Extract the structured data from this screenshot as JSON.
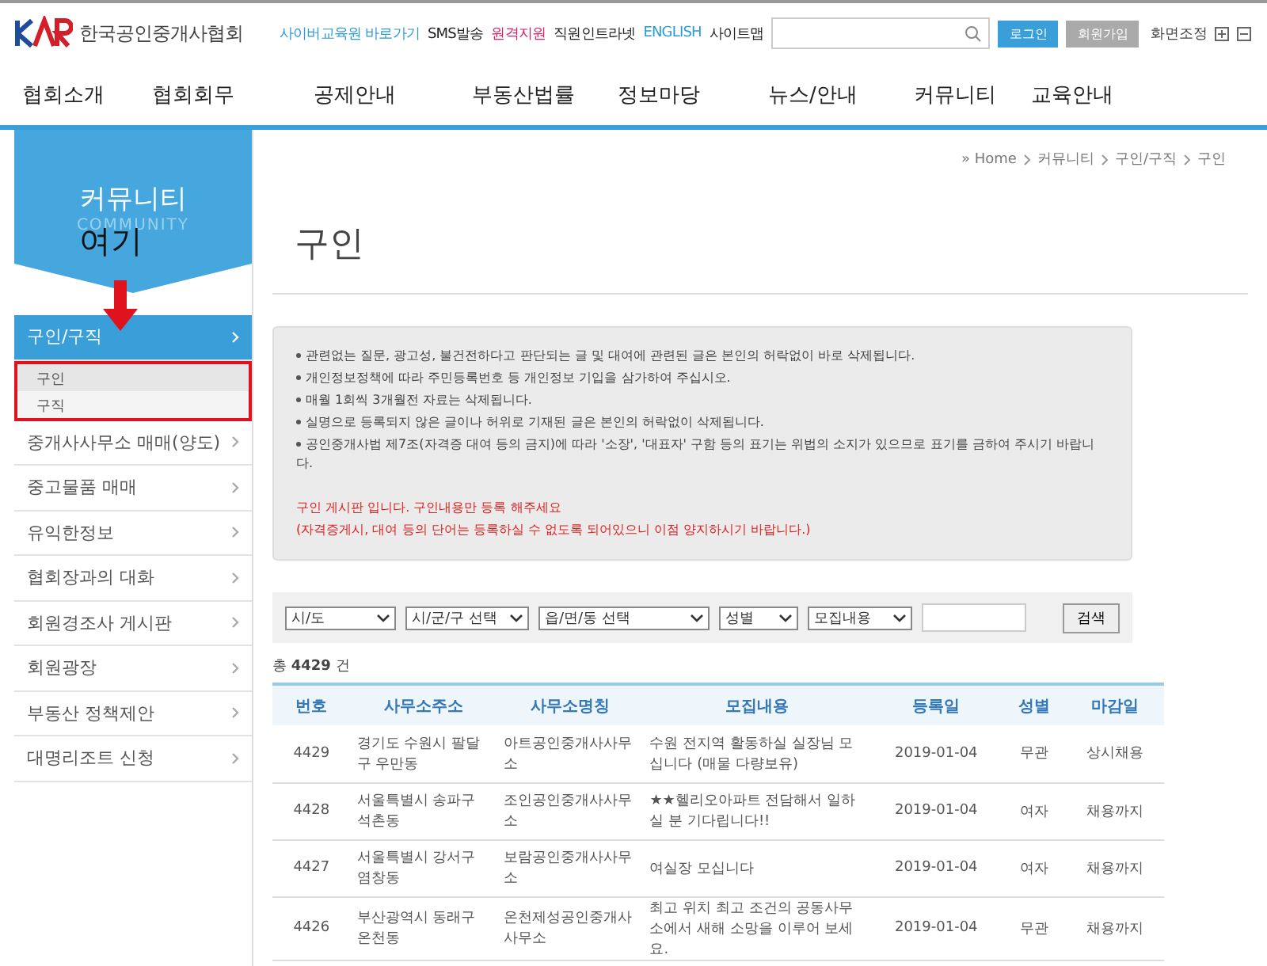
{
  "header": {
    "logo_text": "한국공인중개사협회",
    "links": [
      {
        "label": "사이버교육원 바로가기",
        "kind": "accent"
      },
      {
        "label": "SMS발송",
        "kind": "plain"
      },
      {
        "label": "원격지원",
        "kind": "alert"
      },
      {
        "label": "직원인트라넷",
        "kind": "plain"
      },
      {
        "label": "ENGLISH",
        "kind": "accent"
      },
      {
        "label": "사이트맵",
        "kind": "plain"
      }
    ],
    "login": "로그인",
    "join": "회원가입",
    "zoom_label": "화면조정"
  },
  "nav": [
    "협회소개",
    "협회회무",
    "공제안내",
    "부동산법률",
    "정보마당",
    "뉴스/안내",
    "커뮤니티",
    "교육안내"
  ],
  "sidebar": {
    "title": "커뮤니티",
    "subtitle": "COMMUNITY",
    "annotation": "여기",
    "items": [
      {
        "label": "구인/구직",
        "selected": true,
        "children": [
          {
            "label": "구인",
            "selected": true
          },
          {
            "label": "구직",
            "selected": false
          }
        ]
      },
      {
        "label": "중개사사무소 매매(양도)",
        "selected": false
      },
      {
        "label": "중고물품 매매",
        "selected": false
      },
      {
        "label": "유익한정보",
        "selected": false
      },
      {
        "label": "협회장과의 대화",
        "selected": false
      },
      {
        "label": "회원경조사 게시판",
        "selected": false
      },
      {
        "label": "회원광장",
        "selected": false
      },
      {
        "label": "부동산 정책제안",
        "selected": false
      },
      {
        "label": "대명리조트 신청",
        "selected": false
      }
    ]
  },
  "breadcrumb": [
    "» Home",
    "커뮤니티",
    "구인/구직",
    "구인"
  ],
  "page_title": "구인",
  "notice": {
    "items": [
      "관련없는 질문, 광고성, 불건전하다고 판단되는 글 및 대여에 관련된 글은 본인의 허락없이 바로 삭제됩니다.",
      "개인정보정책에 따라 주민등록번호 등 개인정보 기입을 삼가하여 주십시오.",
      "매월 1회씩 3개월전 자료는 삭제됩니다.",
      "실명으로 등록되지 않은 글이나 허위로 기재된 글은 본인의 허락없이 삭제됩니다.",
      "공인중개사법 제7조(자격증 대여 등의 금지)에 따라 '소장', '대표자' 구함 등의 표기는 위법의 소지가 있으므로 표기를 금하여 주시기 바랍니다."
    ],
    "warnings": [
      "구인 게시판 입니다. 구인내용만 등록 해주세요",
      "(자격증게시, 대여 등의 단어는 등록하실 수 없도록 되어있으니 이점 양지하시기 바랍니다.)"
    ]
  },
  "filters": [
    "시/도",
    "시/군/구 선택",
    "읍/면/동 선택",
    "성별",
    "모집내용"
  ],
  "search_button": "검색",
  "count": {
    "prefix": "총",
    "number": "4429",
    "suffix": "건"
  },
  "table": {
    "columns": [
      "번호",
      "사무소주소",
      "사무소명칭",
      "모집내용",
      "등록일",
      "성별",
      "마감일"
    ],
    "rows": [
      [
        "4429",
        "경기도 수원시 팔달구 우만동",
        "아트공인중개사사무소",
        "수원 전지역 활동하실 실장님 모십니다 (매물 다량보유)",
        "2019-01-04",
        "무관",
        "상시채용"
      ],
      [
        "4428",
        "서울특별시 송파구 석촌동",
        "조인공인중개사사무소",
        "★★헬리오아파트 전담해서 일하실 분 기다립니다!!",
        "2019-01-04",
        "여자",
        "채용까지"
      ],
      [
        "4427",
        "서울특별시 강서구 염창동",
        "보람공인중개사사무소",
        "여실장 모십니다",
        "2019-01-04",
        "여자",
        "채용까지"
      ],
      [
        "4426",
        "부산광역시 동래구 온천동",
        "온천제성공인중개사사무소",
        "최고 위치 최고 조건의 공동사무소에서 새해 소망을 이루어 보세요.",
        "2019-01-04",
        "무관",
        "채용까지"
      ]
    ]
  }
}
